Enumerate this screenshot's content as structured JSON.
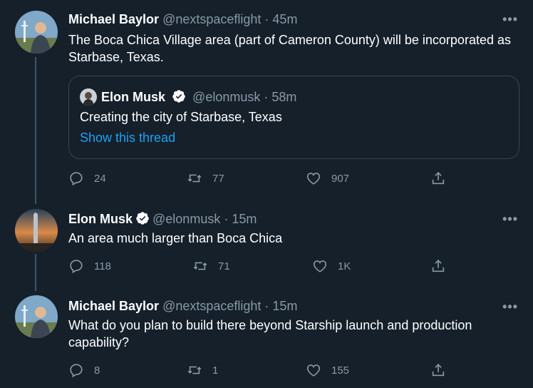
{
  "tweets": [
    {
      "name": "Michael Baylor",
      "handle": "@nextspaceflight",
      "sep": "·",
      "time": "45m",
      "text": "The Boca Chica Village area (part of Cameron County) will be incorporated as Starbase, Texas.",
      "quote": {
        "name": "Elon Musk",
        "handle": "@elonmusk",
        "sep": "·",
        "time": "58m",
        "text": "Creating the city of Starbase, Texas",
        "link": "Show this thread"
      },
      "replies": "24",
      "retweets": "77",
      "likes": "907"
    },
    {
      "name": "Elon Musk",
      "handle": "@elonmusk",
      "sep": "·",
      "time": "15m",
      "text": "An area much larger than Boca Chica",
      "replies": "118",
      "retweets": "71",
      "likes": "1K"
    },
    {
      "name": "Michael Baylor",
      "handle": "@nextspaceflight",
      "sep": "·",
      "time": "15m",
      "text": "What do you plan to build there beyond Starship launch and production capability?",
      "replies": "8",
      "retweets": "1",
      "likes": "155"
    }
  ],
  "more_label": "•••",
  "colors": {
    "background": "#15202b",
    "link": "#1da1f2",
    "muted": "#8899a6",
    "verified": "#ffffff"
  }
}
